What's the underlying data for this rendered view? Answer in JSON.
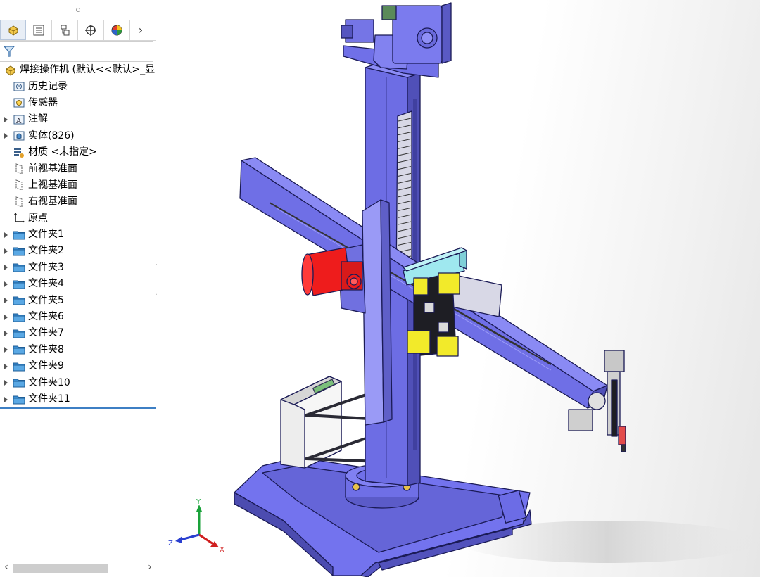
{
  "feature_tree": {
    "tabs": [
      {
        "name": "featuremanager-tab",
        "icon": "part-icon"
      },
      {
        "name": "propertymanager-tab",
        "icon": "property-icon"
      },
      {
        "name": "configurationmanager-tab",
        "icon": "configuration-icon"
      },
      {
        "name": "dimxpert-tab",
        "icon": "crosshair-icon"
      },
      {
        "name": "display-manager-tab",
        "icon": "appearance-pie-icon"
      }
    ],
    "more_label": "›",
    "root_label": "焊接操作机  (默认<<默认>_显",
    "items": [
      {
        "label": "历史记录",
        "icon": "history-icon",
        "expandable": false
      },
      {
        "label": "传感器",
        "icon": "sensor-icon",
        "expandable": false
      },
      {
        "label": "注解",
        "icon": "annotation-icon",
        "expandable": true
      },
      {
        "label": "实体(826)",
        "icon": "solid-bodies-icon",
        "expandable": true
      },
      {
        "label": "材质 <未指定>",
        "icon": "material-icon",
        "expandable": false
      },
      {
        "label": "前视基准面",
        "icon": "plane-icon",
        "expandable": false
      },
      {
        "label": "上视基准面",
        "icon": "plane-icon",
        "expandable": false
      },
      {
        "label": "右视基准面",
        "icon": "plane-icon",
        "expandable": false
      },
      {
        "label": "原点",
        "icon": "origin-icon",
        "expandable": false
      },
      {
        "label": "文件夹1",
        "icon": "folder-icon",
        "expandable": true
      },
      {
        "label": "文件夹2",
        "icon": "folder-icon",
        "expandable": true
      },
      {
        "label": "文件夹3",
        "icon": "folder-icon",
        "expandable": true
      },
      {
        "label": "文件夹4",
        "icon": "folder-icon",
        "expandable": true
      },
      {
        "label": "文件夹5",
        "icon": "folder-icon",
        "expandable": true
      },
      {
        "label": "文件夹6",
        "icon": "folder-icon",
        "expandable": true
      },
      {
        "label": "文件夹7",
        "icon": "folder-icon",
        "expandable": true
      },
      {
        "label": "文件夹8",
        "icon": "folder-icon",
        "expandable": true
      },
      {
        "label": "文件夹9",
        "icon": "folder-icon",
        "expandable": true
      },
      {
        "label": "文件夹10",
        "icon": "folder-icon",
        "expandable": true
      },
      {
        "label": "文件夹11",
        "icon": "folder-icon",
        "expandable": true
      }
    ]
  },
  "scrollbar": {
    "left_arrow": "‹",
    "right_arrow": "›"
  },
  "triad": {
    "x_label": "X",
    "y_label": "Y",
    "z_label": "Z"
  },
  "colors": {
    "model_blue": "#7373ee",
    "model_edge": "#1a1a55",
    "motor_red": "#ee1c1c",
    "drag_chain": "#d8d8e6",
    "cyan_bar": "#9fe8ef",
    "yellow_block": "#f2ea2a",
    "tree_accent": "#3d7fc4"
  }
}
